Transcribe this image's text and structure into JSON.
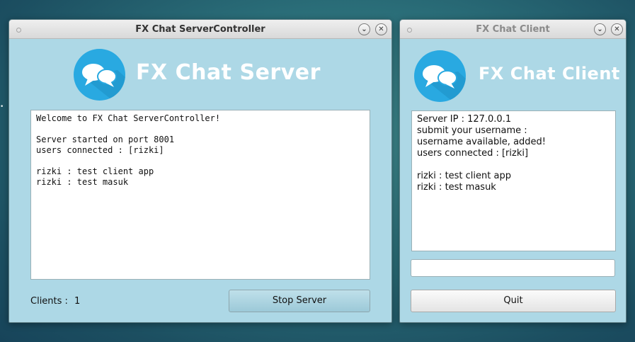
{
  "server_window": {
    "title": "FX Chat ServerController",
    "minimize_glyph": "⌄",
    "close_glyph": "✕",
    "heading": "FX Chat Server",
    "log_lines": [
      "Welcome to FX Chat ServerController!",
      "",
      "Server started on port 8001",
      "users connected : [rizki]",
      "",
      "rizki : test client app",
      "rizki : test masuk"
    ],
    "clients_label": "Clients :",
    "clients_count": "1",
    "stop_button": "Stop Server"
  },
  "client_window": {
    "title": "FX Chat Client",
    "minimize_glyph": "⌄",
    "close_glyph": "✕",
    "heading": "FX Chat Client",
    "log_lines": [
      "Server IP : 127.0.0.1",
      "submit your username :",
      "username available, added!",
      "users connected : [rizki]",
      "",
      "rizki : test client app",
      "rizki : test masuk"
    ],
    "message_input_value": "",
    "quit_button": "Quit"
  },
  "colors": {
    "window_bg": "#add8e6",
    "logo_circle": "#29a9e1",
    "heading_text": "#ffffff"
  },
  "icons": {
    "logo": "chat-bubbles-icon"
  }
}
